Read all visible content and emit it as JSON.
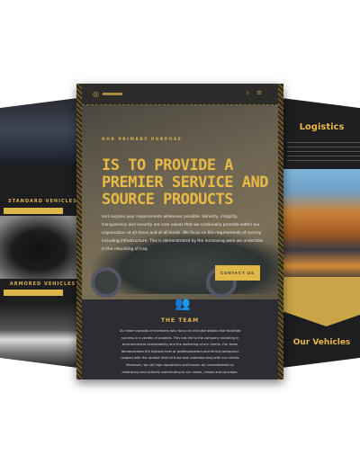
{
  "left_page": {
    "standard_label": "STANDARD VEHICLES",
    "armored_label": "ARMORED VEHICLES"
  },
  "right_page": {
    "logistics_title": "Logistics",
    "vehicles_title": "Our Vehicles"
  },
  "center_page": {
    "kicker": "OUR PRIMARY PURPOSE",
    "headline": "IS TO PROVIDE A PREMIER SERVICE AND SOURCE PRODUCTS",
    "intro": "and surpass your requirements whenever possible. Honesty, integrity, transparency and security are core values that we continually promote within our organisation at all times and at all levels. We focus on the requirements of society including infrastructure. This is demonstrated by the increasing work we undertake in the rebuilding of Iraq.",
    "cta": "CONTACT US",
    "team_title": "THE TEAM",
    "team_text": "Our team consists of members who focus on intricate details that facilitate success in a variety of projects. This has led to the company excelling in environmental sustainability and the wellbeing of our clients. Our team demonstrates the highest level of professionalism and ethical behaviour coupled with the utmost level of trust and understanding with our clients. Moreover, we set high aspirations and honour all commitments by embracing and actively contributing to our vision, values and concepts."
  },
  "colors": {
    "accent": "#e0b84a",
    "dark": "#2b2d33"
  }
}
